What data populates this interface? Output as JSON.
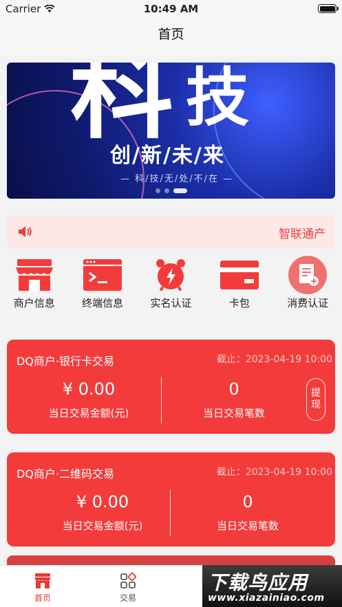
{
  "status_bar": {
    "carrier": "Carrier",
    "time": "10:49 AM"
  },
  "nav": {
    "title": "首页"
  },
  "banner": {
    "big_char_1": "科",
    "big_char_2": "技",
    "headline": "创/新/未/来",
    "tagline": "— 科/技/无/处/不/在 —",
    "page_count": 3,
    "active_page": 2
  },
  "notice": {
    "icon": "speaker-icon",
    "text": "智联通产"
  },
  "quick_actions": [
    {
      "label": "商户信息",
      "icon": "store-icon"
    },
    {
      "label": "终端信息",
      "icon": "terminal-icon"
    },
    {
      "label": "实名认证",
      "icon": "alarm-clock-icon"
    },
    {
      "label": "卡包",
      "icon": "card-icon"
    },
    {
      "label": "消费认证",
      "icon": "document-add-icon"
    }
  ],
  "cards": [
    {
      "title": "DQ商户·银行卡交易",
      "date": "截止：2023-04-19 10:00",
      "amount": "¥ 0.00",
      "amount_label": "当日交易金额(元)",
      "count": "0",
      "count_label": "当日交易笔数",
      "withdraw": "提现"
    },
    {
      "title": "DQ商户·二维码交易",
      "date": "截止：2023-04-19 10:00",
      "amount": "¥ 0.00",
      "amount_label": "当日交易金额(元)",
      "count": "0",
      "count_label": "当日交易笔数"
    }
  ],
  "tabbar": [
    {
      "label": "首页",
      "icon": "home-store-icon",
      "active": true
    },
    {
      "label": "交易",
      "icon": "grid-icon",
      "active": false
    }
  ],
  "watermark": {
    "line1": "下载鸟应用",
    "line2": "www.xiazainiao.com"
  },
  "colors": {
    "accent": "#f33b3b",
    "notice_bg": "#fde8e8",
    "banner": "#1b2ea8"
  }
}
